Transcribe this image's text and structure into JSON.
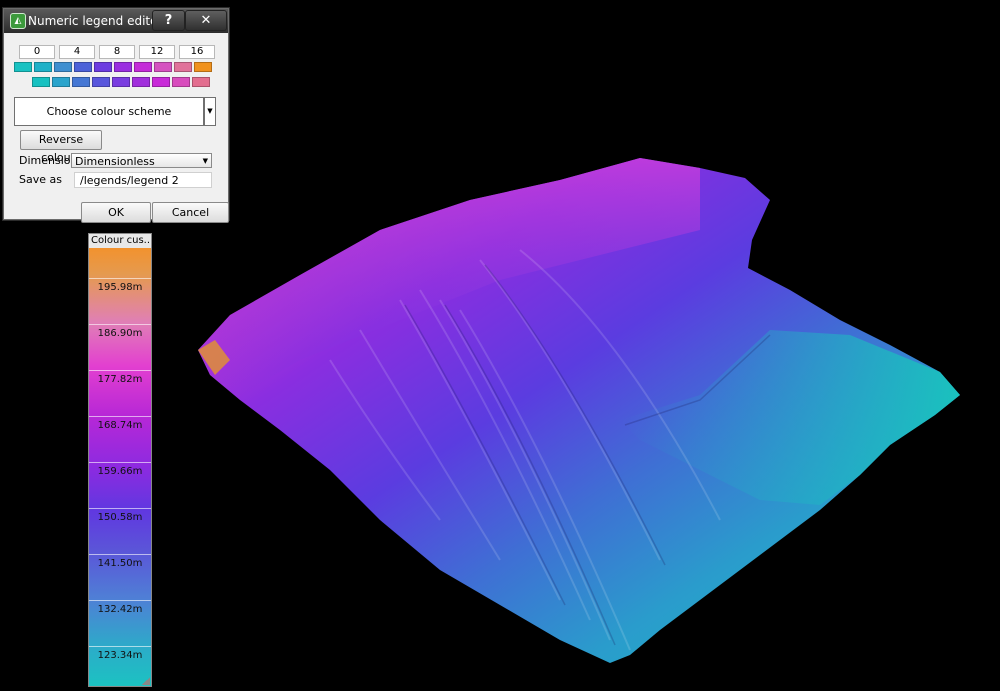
{
  "dialog": {
    "title": "Numeric legend editor",
    "help_label": "?",
    "close_label": "✕",
    "ticks": [
      "0",
      "4",
      "8",
      "12",
      "16"
    ],
    "swatch_colors_top": [
      "#19c2c2",
      "#1fb1c8",
      "#3f8fd0",
      "#4d62d8",
      "#6c3ce0",
      "#9a2fe0",
      "#c42cd8",
      "#d552c0",
      "#e0729a",
      "#f0921e"
    ],
    "swatch_colors_bottom": [
      "#16c1c1",
      "#2aa4cc",
      "#4577d4",
      "#5856dc",
      "#7a3de0",
      "#a12fdc",
      "#c82ad8",
      "#d84cbd",
      "#e36e8f"
    ],
    "choose_scheme_label": "Choose colour scheme",
    "reverse_label": "Reverse colours",
    "dimension_label": "Dimension",
    "dimension_value": "Dimensionless",
    "save_as_label": "Save as",
    "save_as_value": "/legends/legend 2",
    "ok_label": "OK",
    "cancel_label": "Cancel"
  },
  "legend": {
    "title": "Colour cus...",
    "labels": [
      "195.98m",
      "186.90m",
      "177.82m",
      "168.74m",
      "159.66m",
      "150.58m",
      "141.50m",
      "132.42m",
      "123.34m"
    ]
  }
}
